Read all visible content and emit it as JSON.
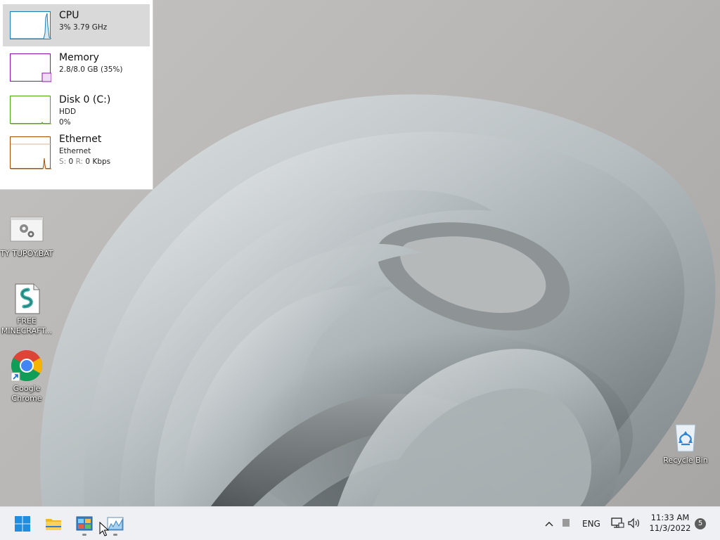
{
  "perf_panel": {
    "items": [
      {
        "title": "CPU",
        "line1": "3% 3.79 GHz",
        "color": "#1b7fb7",
        "selected": true
      },
      {
        "title": "Memory",
        "line1": "2.8/8.0 GB (35%)",
        "color": "#8b12ae"
      },
      {
        "title": "Disk 0 (C:)",
        "line1": "HDD",
        "line2": "0%",
        "color": "#4da60c"
      },
      {
        "title": "Ethernet",
        "line1": "Ethernet",
        "line2_prefix": "S: ",
        "line2_s": "0",
        "line2_mid": " R: ",
        "line2_r": "0 Kbps",
        "color": "#a74f01"
      }
    ]
  },
  "desktop": {
    "icons": [
      {
        "label": "TY TUPOY.BAT",
        "icon": "batch-file-icon"
      },
      {
        "label": "FREE MINECRAFT...",
        "icon": "script-file-icon"
      },
      {
        "label": "Google Chrome",
        "icon": "chrome-icon"
      },
      {
        "label": "Recycle Bin",
        "icon": "recycle-bin-icon"
      }
    ]
  },
  "taskbar": {
    "apps": [
      {
        "name": "Start",
        "icon": "windows-start-icon"
      },
      {
        "name": "File Explorer",
        "icon": "folder-icon"
      },
      {
        "name": "Control Panel",
        "icon": "control-panel-icon",
        "running": true
      },
      {
        "name": "Task Manager",
        "icon": "task-manager-icon",
        "running": true
      }
    ],
    "tray": {
      "language": "ENG",
      "time": "11:33 AM",
      "date": "11/3/2022",
      "notifications": "5"
    }
  }
}
